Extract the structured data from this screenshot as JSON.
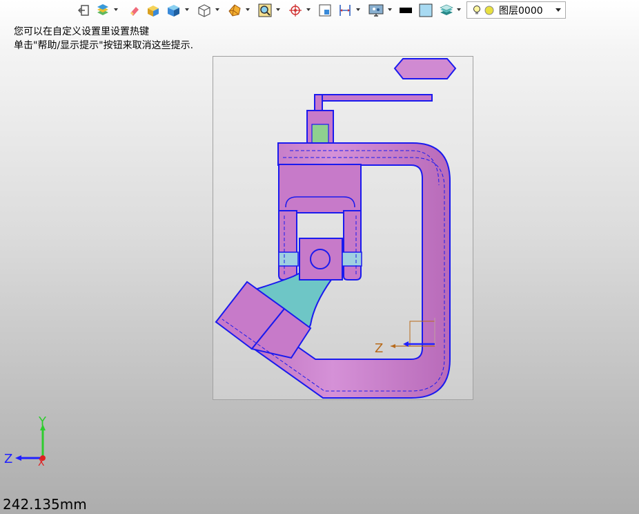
{
  "toolbar": {
    "items": [
      {
        "icon": "exit-sketch-icon"
      },
      {
        "icon": "layer-manager-icon"
      },
      {
        "icon": "eraser-icon"
      },
      {
        "icon": "shaded-solid-icon"
      },
      {
        "icon": "view-style-icon"
      },
      {
        "icon": "wireframe-cube-icon"
      },
      {
        "icon": "polygon-render-icon"
      },
      {
        "icon": "zoom-fit-icon"
      },
      {
        "icon": "target-snap-icon"
      },
      {
        "icon": "frame-icon"
      },
      {
        "icon": "dimension-icon"
      },
      {
        "icon": "display-settings-icon"
      },
      {
        "icon": "line-color-icon"
      },
      {
        "icon": "face-color-icon"
      },
      {
        "icon": "layers-stack-icon"
      }
    ],
    "colors": {
      "line_color": "#000000",
      "face_color": "#a8daf2"
    },
    "layer": {
      "name": "图层0000",
      "bulb_icon": "lightbulb-icon",
      "status_icon": "layer-status-icon"
    }
  },
  "hints": {
    "line1": "您可以在自定义设置里设置热键",
    "line2": "单击\"帮助/显示提示\"按钮来取消这些提示."
  },
  "model_axes": {
    "z_label": "Z"
  },
  "view_triad": {
    "y_label": "Y",
    "z_label": "Z",
    "x_label": "X"
  },
  "measurement": {
    "value": "242.135mm"
  },
  "colors": {
    "part_fill": "#c77ac9",
    "part_fill_light": "#d08ad2",
    "cyan_fill": "#6ec6c6",
    "edge": "#1a1aee",
    "axis_z": "#b86a1a",
    "triad_y": "#2ecc2e",
    "triad_z": "#2020ff",
    "triad_x": "#e02020"
  }
}
